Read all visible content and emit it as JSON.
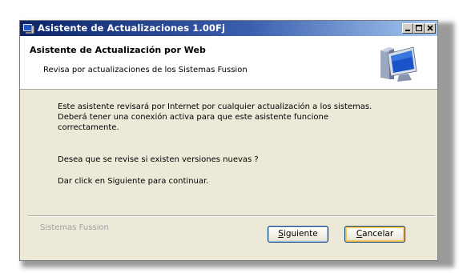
{
  "window": {
    "title": "Asistente de Actualizaciones 1.00Fj",
    "controls": [
      "minimize",
      "maximize",
      "close"
    ]
  },
  "header": {
    "title": "Asistente de Actualización por Web",
    "subtitle": "Revisa por actualizaciones de los Sistemas Fussion",
    "icon": "computer-monitor-icon"
  },
  "body": {
    "line1": "Este asistente revisará por Internet por cualquier actualización a los sistemas.",
    "line2": "Deberá tener una conexión activa para que este asistente funcione",
    "line3": "correctamente.",
    "question": "Desea que se revise si existen versiones nuevas ?",
    "instruction": "Dar click en Siguiente para continuar."
  },
  "footer": {
    "brand": "Sistemas Fussion",
    "next_first": "S",
    "next_rest": "iguiente",
    "cancel_first": "C",
    "cancel_rest": "ancelar"
  },
  "colors": {
    "titlebar_start": "#0a246a",
    "titlebar_end": "#a6caf0",
    "dialog_bg": "#ece9d8",
    "button_border": "#003c74"
  }
}
